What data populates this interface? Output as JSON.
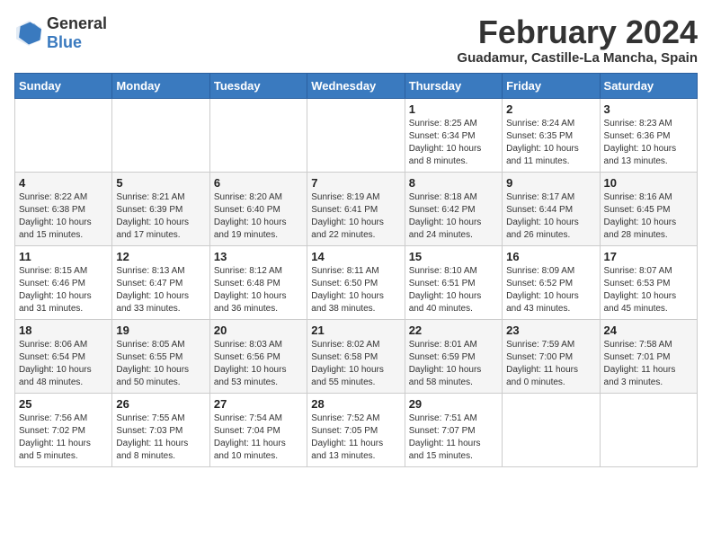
{
  "header": {
    "logo_general": "General",
    "logo_blue": "Blue",
    "title": "February 2024",
    "subtitle": "Guadamur, Castille-La Mancha, Spain"
  },
  "days_of_week": [
    "Sunday",
    "Monday",
    "Tuesday",
    "Wednesday",
    "Thursday",
    "Friday",
    "Saturday"
  ],
  "weeks": [
    [
      {
        "day": "",
        "info": ""
      },
      {
        "day": "",
        "info": ""
      },
      {
        "day": "",
        "info": ""
      },
      {
        "day": "",
        "info": ""
      },
      {
        "day": "1",
        "info": "Sunrise: 8:25 AM\nSunset: 6:34 PM\nDaylight: 10 hours\nand 8 minutes."
      },
      {
        "day": "2",
        "info": "Sunrise: 8:24 AM\nSunset: 6:35 PM\nDaylight: 10 hours\nand 11 minutes."
      },
      {
        "day": "3",
        "info": "Sunrise: 8:23 AM\nSunset: 6:36 PM\nDaylight: 10 hours\nand 13 minutes."
      }
    ],
    [
      {
        "day": "4",
        "info": "Sunrise: 8:22 AM\nSunset: 6:38 PM\nDaylight: 10 hours\nand 15 minutes."
      },
      {
        "day": "5",
        "info": "Sunrise: 8:21 AM\nSunset: 6:39 PM\nDaylight: 10 hours\nand 17 minutes."
      },
      {
        "day": "6",
        "info": "Sunrise: 8:20 AM\nSunset: 6:40 PM\nDaylight: 10 hours\nand 19 minutes."
      },
      {
        "day": "7",
        "info": "Sunrise: 8:19 AM\nSunset: 6:41 PM\nDaylight: 10 hours\nand 22 minutes."
      },
      {
        "day": "8",
        "info": "Sunrise: 8:18 AM\nSunset: 6:42 PM\nDaylight: 10 hours\nand 24 minutes."
      },
      {
        "day": "9",
        "info": "Sunrise: 8:17 AM\nSunset: 6:44 PM\nDaylight: 10 hours\nand 26 minutes."
      },
      {
        "day": "10",
        "info": "Sunrise: 8:16 AM\nSunset: 6:45 PM\nDaylight: 10 hours\nand 28 minutes."
      }
    ],
    [
      {
        "day": "11",
        "info": "Sunrise: 8:15 AM\nSunset: 6:46 PM\nDaylight: 10 hours\nand 31 minutes."
      },
      {
        "day": "12",
        "info": "Sunrise: 8:13 AM\nSunset: 6:47 PM\nDaylight: 10 hours\nand 33 minutes."
      },
      {
        "day": "13",
        "info": "Sunrise: 8:12 AM\nSunset: 6:48 PM\nDaylight: 10 hours\nand 36 minutes."
      },
      {
        "day": "14",
        "info": "Sunrise: 8:11 AM\nSunset: 6:50 PM\nDaylight: 10 hours\nand 38 minutes."
      },
      {
        "day": "15",
        "info": "Sunrise: 8:10 AM\nSunset: 6:51 PM\nDaylight: 10 hours\nand 40 minutes."
      },
      {
        "day": "16",
        "info": "Sunrise: 8:09 AM\nSunset: 6:52 PM\nDaylight: 10 hours\nand 43 minutes."
      },
      {
        "day": "17",
        "info": "Sunrise: 8:07 AM\nSunset: 6:53 PM\nDaylight: 10 hours\nand 45 minutes."
      }
    ],
    [
      {
        "day": "18",
        "info": "Sunrise: 8:06 AM\nSunset: 6:54 PM\nDaylight: 10 hours\nand 48 minutes."
      },
      {
        "day": "19",
        "info": "Sunrise: 8:05 AM\nSunset: 6:55 PM\nDaylight: 10 hours\nand 50 minutes."
      },
      {
        "day": "20",
        "info": "Sunrise: 8:03 AM\nSunset: 6:56 PM\nDaylight: 10 hours\nand 53 minutes."
      },
      {
        "day": "21",
        "info": "Sunrise: 8:02 AM\nSunset: 6:58 PM\nDaylight: 10 hours\nand 55 minutes."
      },
      {
        "day": "22",
        "info": "Sunrise: 8:01 AM\nSunset: 6:59 PM\nDaylight: 10 hours\nand 58 minutes."
      },
      {
        "day": "23",
        "info": "Sunrise: 7:59 AM\nSunset: 7:00 PM\nDaylight: 11 hours\nand 0 minutes."
      },
      {
        "day": "24",
        "info": "Sunrise: 7:58 AM\nSunset: 7:01 PM\nDaylight: 11 hours\nand 3 minutes."
      }
    ],
    [
      {
        "day": "25",
        "info": "Sunrise: 7:56 AM\nSunset: 7:02 PM\nDaylight: 11 hours\nand 5 minutes."
      },
      {
        "day": "26",
        "info": "Sunrise: 7:55 AM\nSunset: 7:03 PM\nDaylight: 11 hours\nand 8 minutes."
      },
      {
        "day": "27",
        "info": "Sunrise: 7:54 AM\nSunset: 7:04 PM\nDaylight: 11 hours\nand 10 minutes."
      },
      {
        "day": "28",
        "info": "Sunrise: 7:52 AM\nSunset: 7:05 PM\nDaylight: 11 hours\nand 13 minutes."
      },
      {
        "day": "29",
        "info": "Sunrise: 7:51 AM\nSunset: 7:07 PM\nDaylight: 11 hours\nand 15 minutes."
      },
      {
        "day": "",
        "info": ""
      },
      {
        "day": "",
        "info": ""
      }
    ]
  ]
}
